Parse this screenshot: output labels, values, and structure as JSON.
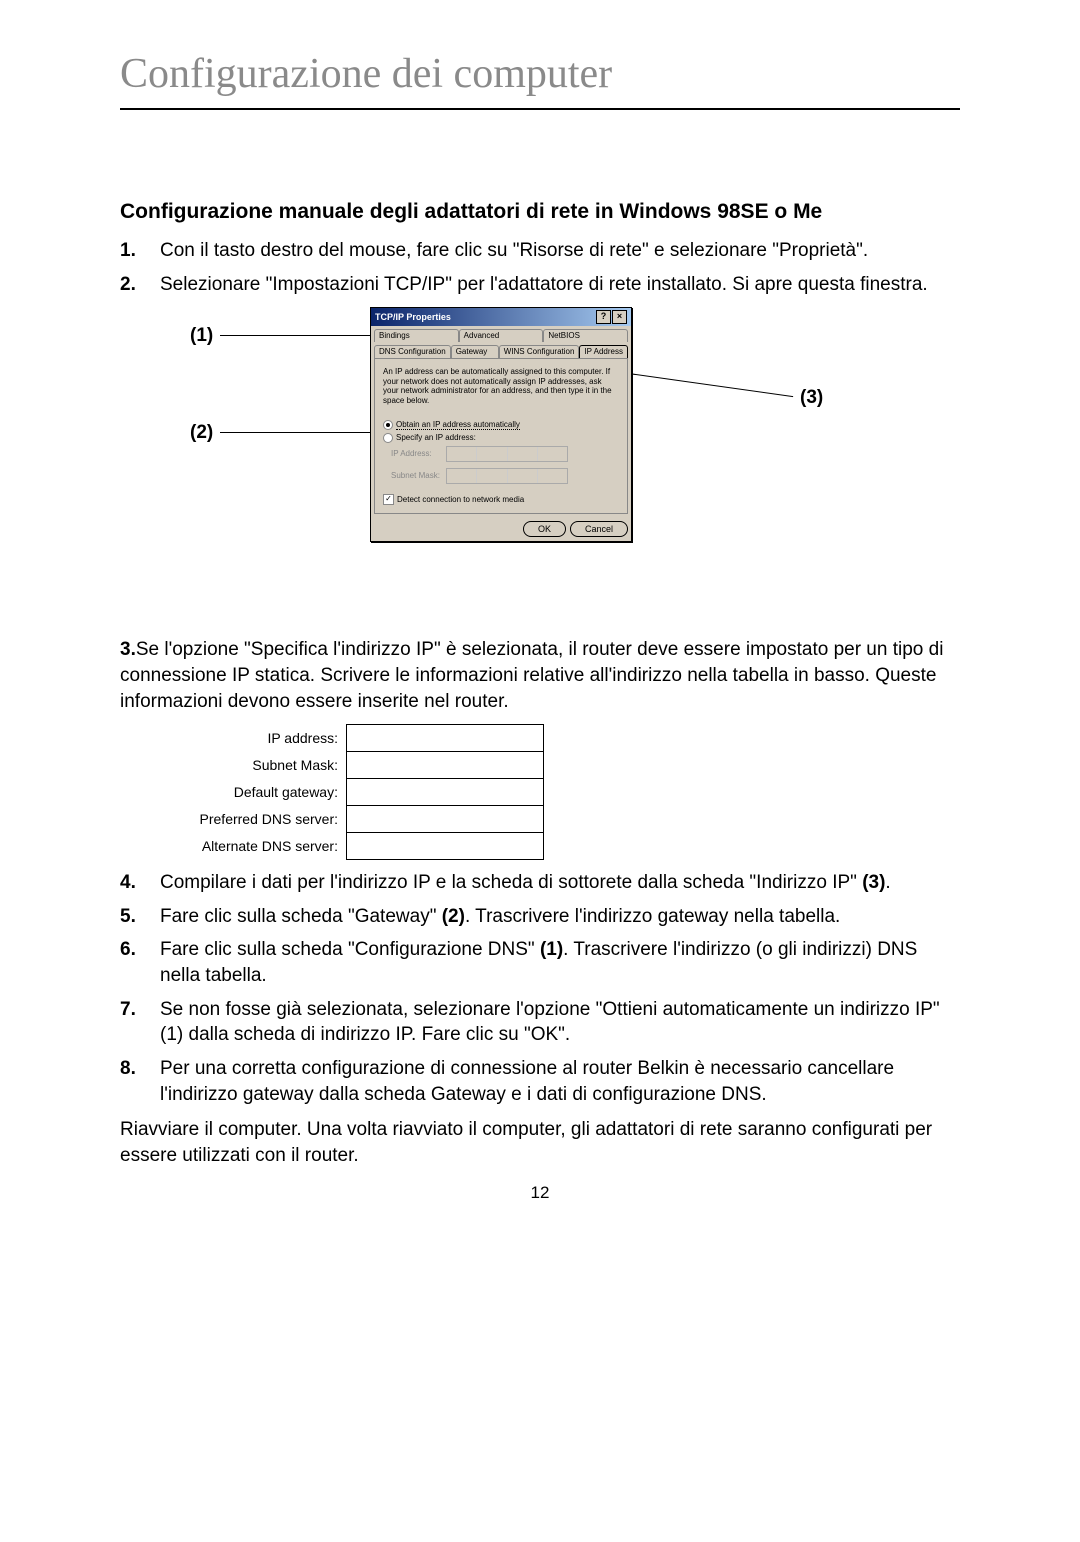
{
  "chapter_title": "Configurazione dei computer",
  "section_title": "Configurazione manuale degli adattatori di rete in Windows 98SE o Me",
  "steps12": [
    {
      "num": "1.",
      "text": "Con il tasto destro del mouse, fare clic su \"Risorse di rete\" e selezionare \"Proprietà\"."
    },
    {
      "num": "2.",
      "text": "Selezionare \"Impostazioni TCP/IP\" per l'adattatore di rete installato. Si apre questa finestra."
    }
  ],
  "callouts": {
    "c1": "(1)",
    "c2": "(2)",
    "c3": "(3)"
  },
  "dialog": {
    "title": "TCP/IP Properties",
    "help_icon": "?",
    "close_icon": "×",
    "tabs_row1": [
      "Bindings",
      "Advanced",
      "NetBIOS"
    ],
    "tabs_row2": [
      "DNS Configuration",
      "Gateway",
      "WINS Configuration",
      "IP Address"
    ],
    "desc": "An IP address can be automatically assigned to this computer. If your network does not automatically assign IP addresses, ask your network administrator for an address, and then type it in the space below.",
    "radio_obtain": "Obtain an IP address automatically",
    "radio_specify": "Specify an IP address:",
    "ip_label": "IP Address:",
    "mask_label": "Subnet Mask:",
    "detect_label": "Detect connection to network media",
    "ok": "OK",
    "cancel": "Cancel"
  },
  "step3": {
    "num": "3.",
    "text": "Se l'opzione \"Specifica l'indirizzo IP\" è selezionata, il router deve essere impostato per un tipo di connessione IP statica. Scrivere le informazioni relative all'indirizzo nella tabella in basso. Queste informazioni devono essere inserite nel router."
  },
  "info_table": [
    "IP address:",
    "Subnet Mask:",
    "Default gateway:",
    "Preferred DNS server:",
    "Alternate DNS server:"
  ],
  "steps48": [
    {
      "num": "4.",
      "pre": "Compilare i dati per l'indirizzo IP e la scheda di sottorete dalla scheda \"Indirizzo IP\" ",
      "bold": "(3)",
      "post": "."
    },
    {
      "num": "5.",
      "pre": "Fare clic sulla scheda \"Gateway\" ",
      "bold": "(2)",
      "post": ". Trascrivere l'indirizzo gateway nella tabella."
    },
    {
      "num": "6.",
      "pre": "Fare clic sulla scheda \"Configurazione DNS\" ",
      "bold": "(1)",
      "post": ". Trascrivere l'indirizzo (o gli indirizzi) DNS nella tabella."
    },
    {
      "num": "7.",
      "pre": "Se non fosse già selezionata, selezionare l'opzione \"Ottieni automaticamente un indirizzo IP\" (1) dalla scheda di indirizzo IP. Fare clic su \"OK\".",
      "bold": "",
      "post": ""
    },
    {
      "num": "8.",
      "pre": "Per una corretta configurazione di connessione al router Belkin è necessario cancellare l'indirizzo gateway dalla scheda Gateway e i dati di configurazione DNS.",
      "bold": "",
      "post": ""
    }
  ],
  "final_para": "Riavviare il computer. Una volta riavviato il computer, gli adattatori di rete saranno configurati per essere utilizzati con il router.",
  "page_number": "12"
}
